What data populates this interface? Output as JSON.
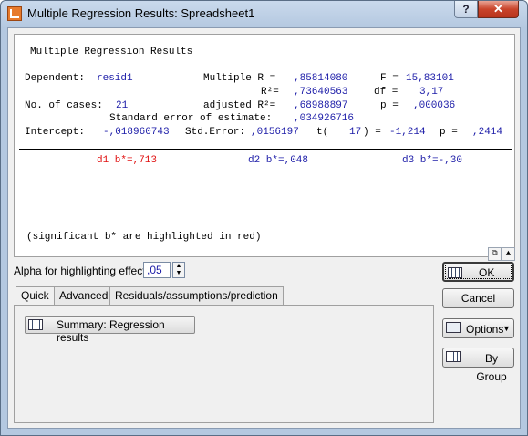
{
  "window": {
    "title": "Multiple Regression Results: Spreadsheet1",
    "help_label": "?",
    "close_label": "✕"
  },
  "results": {
    "heading": "Multiple Regression Results",
    "dependent_label": "Dependent:",
    "dependent_value": "resid1",
    "multiple_r_label": "Multiple R =",
    "multiple_r_value": ",85814080",
    "f_label": "F =",
    "f_value": "15,83101",
    "r2_label": "R²=",
    "r2_value": ",73640563",
    "df_label": "df =",
    "df_value": "3,17",
    "cases_label": "No. of cases:",
    "cases_value": "21",
    "adj_r2_label": "adjusted R²=",
    "adj_r2_value": ",68988897",
    "p_label": "p =",
    "p_value": ",000036",
    "std_err_label": "Standard error of estimate:",
    "std_err_value": ",034926716",
    "intercept_label": "Intercept:",
    "intercept_value": "-,018960743",
    "intercept_stderr_label": "Std.Error:",
    "intercept_stderr_value": ",0156197",
    "t_label": "t(",
    "t_df": "17",
    "t_eq": ") =",
    "t_value": "-1,214",
    "intercept_p_label": "p =",
    "intercept_p_value": ",2414",
    "coefficients": [
      {
        "text": "d1 b*=,713",
        "color": "#e01010"
      },
      {
        "text": "d2 b*=,048",
        "color": "#1c1ca8"
      },
      {
        "text": "d3 b*=-,30",
        "color": "#1c1ca8"
      }
    ],
    "footnote": "(significant b* are highlighted in red)"
  },
  "alpha": {
    "label": "Alpha for highlighting effects:",
    "value": ",05"
  },
  "tabs": [
    {
      "label": "Quick"
    },
    {
      "label": "Advanced"
    },
    {
      "label": "Residuals/assumptions/prediction"
    }
  ],
  "summary_button": "Summary:  Regression results",
  "buttons": {
    "ok": "OK",
    "cancel": "Cancel",
    "options": "Options",
    "by_group": "By Group"
  }
}
